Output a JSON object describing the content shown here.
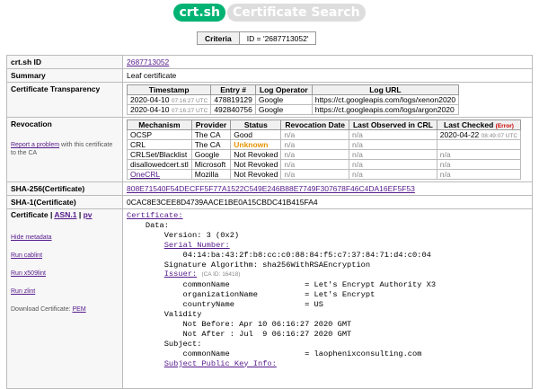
{
  "header": {
    "logo": "crt.sh",
    "title": "Certificate Search"
  },
  "criteria": {
    "label": "Criteria",
    "value": "ID = '2687713052'"
  },
  "rows": {
    "crtsh_id": {
      "label": "crt.sh ID",
      "value": "2687713052"
    },
    "summary": {
      "label": "Summary",
      "value": "Leaf certificate"
    },
    "ct": {
      "label": "Certificate Transparency",
      "headers": [
        "Timestamp",
        "Entry #",
        "Log Operator",
        "Log URL"
      ],
      "entries": [
        {
          "date": "2020-04-10",
          "time": "07:16:27 UTC",
          "entry": "478819129",
          "operator": "Google",
          "url": "https://ct.googleapis.com/logs/xenon2020"
        },
        {
          "date": "2020-04-10",
          "time": "07:16:27 UTC",
          "entry": "492840756",
          "operator": "Google",
          "url": "https://ct.googleapis.com/logs/argon2020"
        }
      ]
    },
    "revocation": {
      "label": "Revocation",
      "report_link": "Report a problem",
      "report_note": "with this certificate to the CA",
      "headers": [
        "Mechanism",
        "Provider",
        "Status",
        "Revocation Date",
        "Last Observed in CRL",
        "Last Checked"
      ],
      "error_label": "(Error)",
      "items": [
        {
          "mechanism": "OCSP",
          "provider": "The CA",
          "status": "Good",
          "revdate": "n/a",
          "observed": "n/a",
          "checked": "2020-04-22",
          "checked_time": "08:49:07 UTC"
        },
        {
          "mechanism": "CRL",
          "provider": "The CA",
          "status": "Unknown",
          "revdate": "n/a",
          "observed": "n/a",
          "checked": "",
          "checked_time": ""
        },
        {
          "mechanism": "CRLSet/Blacklist",
          "provider": "Google",
          "status": "Not Revoked",
          "revdate": "n/a",
          "observed": "n/a",
          "checked": "n/a",
          "checked_time": ""
        },
        {
          "mechanism": "disallowedcert.stl",
          "provider": "Microsoft",
          "status": "Not Revoked",
          "revdate": "n/a",
          "observed": "n/a",
          "checked": "n/a",
          "checked_time": ""
        },
        {
          "mechanism": "OneCRL",
          "provider": "Mozilla",
          "status": "Not Revoked",
          "revdate": "n/a",
          "observed": "n/a",
          "checked": "n/a",
          "checked_time": ""
        }
      ]
    },
    "sha256": {
      "label": "SHA-256(Certificate)",
      "value": "808E71540F54DECFF5F77A1522C549E246B88E7749F307678F46C4DA16EF5F53"
    },
    "sha1": {
      "label": "SHA-1(Certificate)",
      "value": "0CAC8E3CEE8D4739AACE1BE0A15CBDC41B415FA4"
    },
    "certificate": {
      "label": "Certificate",
      "sep": "|",
      "asn1": "ASN.1",
      "pv": "pv",
      "hide_metadata": "Hide metadata",
      "run_cablint": "Run cablint",
      "run_x509lint": "Run x509lint",
      "run_zlint": "Run zlint",
      "download_label": "Download Certificate:",
      "pem": "PEM",
      "text": {
        "certificate": "Certificate:",
        "data": "    Data:",
        "version": "        Version: 3 (0x2)",
        "serial_label": "Serial Number:",
        "serial_value": "            04:14:ba:43:2f:b8:cc:c0:88:84:f5:c7:37:84:71:d4:c0:04",
        "sig_alg": "        Signature Algorithm: sha256WithRSAEncryption",
        "issuer_label": "Issuer:",
        "issuer_caid": "(CA ID: 16418)",
        "issuer_cn": "            commonName                = Let's Encrypt Authority X3",
        "issuer_o": "            organizationName          = Let's Encrypt",
        "issuer_c": "            countryName               = US",
        "validity": "        Validity",
        "not_before": "            Not Before: Apr 10 06:16:27 2020 GMT",
        "not_after": "            Not After : Jul  9 06:16:27 2020 GMT",
        "subject": "        Subject:",
        "subject_cn": "            commonName                = laophenixconsulting.com",
        "spki_label": "Subject Public Key Info:"
      }
    }
  }
}
